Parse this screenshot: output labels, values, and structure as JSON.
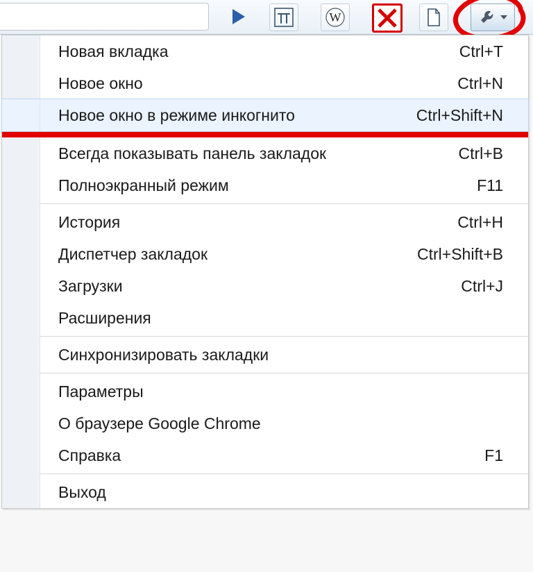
{
  "toolbar": {
    "icons": {
      "play": "play-icon",
      "pi": "pi-icon",
      "w": "wikipedia-icon",
      "x": "blocked-icon",
      "file": "new-file-icon",
      "wrench": "wrench-icon"
    }
  },
  "menu": {
    "items": [
      {
        "label": "Новая вкладка",
        "shortcut": "Ctrl+T",
        "highlight": false,
        "sep_after": false
      },
      {
        "label": "Новое окно",
        "shortcut": "Ctrl+N",
        "highlight": false,
        "sep_after": false
      },
      {
        "label": "Новое окно в режиме инкогнито",
        "shortcut": "Ctrl+Shift+N",
        "highlight": true,
        "red_after": true,
        "sep_after": false
      },
      {
        "label": "Всегда показывать панель закладок",
        "shortcut": "Ctrl+B",
        "highlight": false,
        "sep_after": false
      },
      {
        "label": "Полноэкранный режим",
        "shortcut": "F11",
        "highlight": false,
        "sep_after": true
      },
      {
        "label": "История",
        "shortcut": "Ctrl+H",
        "highlight": false,
        "sep_after": false
      },
      {
        "label": "Диспетчер закладок",
        "shortcut": "Ctrl+Shift+B",
        "highlight": false,
        "sep_after": false
      },
      {
        "label": "Загрузки",
        "shortcut": "Ctrl+J",
        "highlight": false,
        "sep_after": false
      },
      {
        "label": "Расширения",
        "shortcut": "",
        "highlight": false,
        "sep_after": true
      },
      {
        "label": "Синхронизировать закладки",
        "shortcut": "",
        "highlight": false,
        "sep_after": true
      },
      {
        "label": "Параметры",
        "shortcut": "",
        "highlight": false,
        "sep_after": false
      },
      {
        "label": "О браузере Google Chrome",
        "shortcut": "",
        "highlight": false,
        "sep_after": false
      },
      {
        "label": "Справка",
        "shortcut": "F1",
        "highlight": false,
        "sep_after": true
      },
      {
        "label": "Выход",
        "shortcut": "",
        "highlight": false,
        "sep_after": false
      }
    ]
  },
  "colors": {
    "annotation": "#e20000"
  }
}
